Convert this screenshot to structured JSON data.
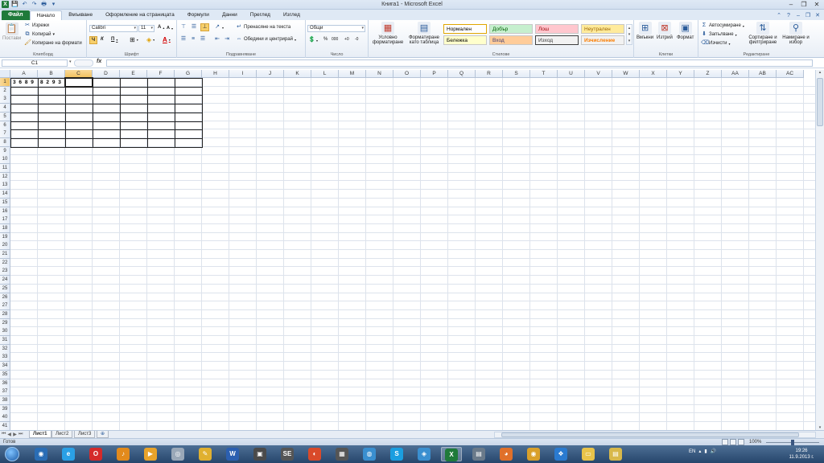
{
  "window": {
    "title": "Книга1 - Microsoft Excel",
    "minimize": "–",
    "restore": "❐",
    "close": "✕"
  },
  "qat": [
    "X",
    "💾",
    "↶",
    "↷",
    "🖶",
    "▾"
  ],
  "ribbon_tabs": [
    "Файл",
    "Начало",
    "Вмъкване",
    "Оформление на страницата",
    "Формули",
    "Данни",
    "Преглед",
    "Изглед"
  ],
  "active_tab": "Начало",
  "ribbon_right": [
    "⌃",
    "?",
    "–",
    "❐",
    "✕"
  ],
  "clipboard": {
    "label": "Клипборд",
    "paste": "Постави",
    "cut": "Изрежи",
    "copy": "Копирай",
    "format_painter": "Копиране на формати"
  },
  "font": {
    "label": "Шрифт",
    "name": "Calibri",
    "size": "11",
    "grow": "A",
    "shrink": "A",
    "bold": "Ч",
    "italic": "К",
    "underline": "П",
    "borders": "⊞",
    "fill": "◈",
    "color": "A"
  },
  "alignment": {
    "label": "Подравняване",
    "wrap": "Пренасяне на текста",
    "merge": "Обедини и центрирай"
  },
  "number": {
    "label": "Число",
    "format": "Общи",
    "currency": "💲",
    "percent": "%",
    "comma": "000",
    "inc_decimal": "+0",
    "dec_decimal": "-0"
  },
  "styles": {
    "label": "Стилове",
    "conditional": "Условно форматиране",
    "as_table": "Форматиране като таблица",
    "cells": [
      {
        "name": "Нормален",
        "bg": "#ffffff",
        "fg": "#000000"
      },
      {
        "name": "Добър",
        "bg": "#c6efce",
        "fg": "#006100"
      },
      {
        "name": "Лош",
        "bg": "#ffc7ce",
        "fg": "#9c0006"
      },
      {
        "name": "Неутрален",
        "bg": "#ffeb9c",
        "fg": "#9c6500"
      },
      {
        "name": "Бележка",
        "bg": "#ffffcc",
        "fg": "#000000"
      },
      {
        "name": "Вход",
        "bg": "#ffcc99",
        "fg": "#3f3f76"
      },
      {
        "name": "Изход",
        "bg": "#f2f2f2",
        "fg": "#3f3f3f"
      },
      {
        "name": "Изчисление",
        "bg": "#f2f2f2",
        "fg": "#fa7d00"
      }
    ]
  },
  "cells_group": {
    "label": "Клетки",
    "insert": "Вмъкни",
    "delete": "Изтрий",
    "format": "Формат"
  },
  "editing": {
    "label": "Редактиране",
    "autosum": "Автосумиране",
    "fill": "Запълване",
    "clear": "Изчисти",
    "sort": "Сортиране и филтриране",
    "find": "Намиране и избор"
  },
  "formula_bar": {
    "name_box": "C1",
    "fx": "fx",
    "value": ""
  },
  "columns": [
    "A",
    "B",
    "C",
    "D",
    "E",
    "F",
    "G",
    "H",
    "I",
    "J",
    "K",
    "L",
    "M",
    "N",
    "O",
    "P",
    "Q",
    "R",
    "S",
    "T",
    "U",
    "V",
    "W",
    "X",
    "Y",
    "Z",
    "AA",
    "AB",
    "AC"
  ],
  "rows": [
    "1",
    "2",
    "3",
    "4",
    "5",
    "6",
    "7",
    "8",
    "9",
    "10",
    "11",
    "12",
    "13",
    "14",
    "15",
    "16",
    "17",
    "18",
    "19",
    "20",
    "21",
    "22",
    "23",
    "24",
    "25",
    "26",
    "27",
    "28",
    "29",
    "30",
    "31",
    "32",
    "33",
    "34",
    "35",
    "36",
    "37",
    "38",
    "39",
    "40",
    "41"
  ],
  "selected_cell": {
    "col": "C",
    "row": "1"
  },
  "cell_values": {
    "A1": "3 6 8 9",
    "B1": "8 2 9 3"
  },
  "sheets": [
    "Лист1",
    "Лист2",
    "Лист3"
  ],
  "active_sheet": "Лист1",
  "new_sheet": "⊕",
  "status": {
    "text": "Готов",
    "zoom": "100%"
  },
  "taskbar": {
    "apps": [
      {
        "name": "chrome-icon",
        "glyph": "◉",
        "color": "#2a6db5"
      },
      {
        "name": "ie-icon",
        "glyph": "e",
        "color": "#2aa0e6"
      },
      {
        "name": "opera-icon",
        "glyph": "O",
        "color": "#d42a2a"
      },
      {
        "name": "audio-icon",
        "glyph": "♪",
        "color": "#e28a1c"
      },
      {
        "name": "media-player-icon",
        "glyph": "▶",
        "color": "#e8a32b"
      },
      {
        "name": "disc-icon",
        "glyph": "◎",
        "color": "#9aa8b8"
      },
      {
        "name": "pen-icon",
        "glyph": "✎",
        "color": "#e0b030"
      },
      {
        "name": "word-icon",
        "glyph": "W",
        "color": "#2b5fb0"
      },
      {
        "name": "film-icon",
        "glyph": "▣",
        "color": "#4a4a4a"
      },
      {
        "name": "app-se-icon",
        "glyph": "SE",
        "color": "#555555"
      },
      {
        "name": "cd-burner-icon",
        "glyph": "◐",
        "color": "#d94a2a"
      },
      {
        "name": "calendar-icon",
        "glyph": "▦",
        "color": "#555555"
      },
      {
        "name": "globe-icon",
        "glyph": "◍",
        "color": "#3a8fd0"
      },
      {
        "name": "skype-icon",
        "glyph": "S",
        "color": "#1a9ee0"
      },
      {
        "name": "compass-icon",
        "glyph": "◈",
        "color": "#3a8fd0"
      },
      {
        "name": "excel-icon",
        "glyph": "X",
        "color": "#1f7a3a"
      },
      {
        "name": "notes-icon",
        "glyph": "▤",
        "color": "#6a7a8a"
      },
      {
        "name": "firefox-icon",
        "glyph": "◕",
        "color": "#e0702a"
      },
      {
        "name": "chrome2-icon",
        "glyph": "◉",
        "color": "#d9a02a"
      },
      {
        "name": "butterfly-icon",
        "glyph": "❖",
        "color": "#2a7ad0"
      },
      {
        "name": "folder-icon",
        "glyph": "▭",
        "color": "#e8c34a"
      },
      {
        "name": "explorer-icon",
        "glyph": "▤",
        "color": "#d8b84a"
      }
    ],
    "lang": "EN",
    "time": "19:26",
    "date": "11.9.2013 г."
  }
}
